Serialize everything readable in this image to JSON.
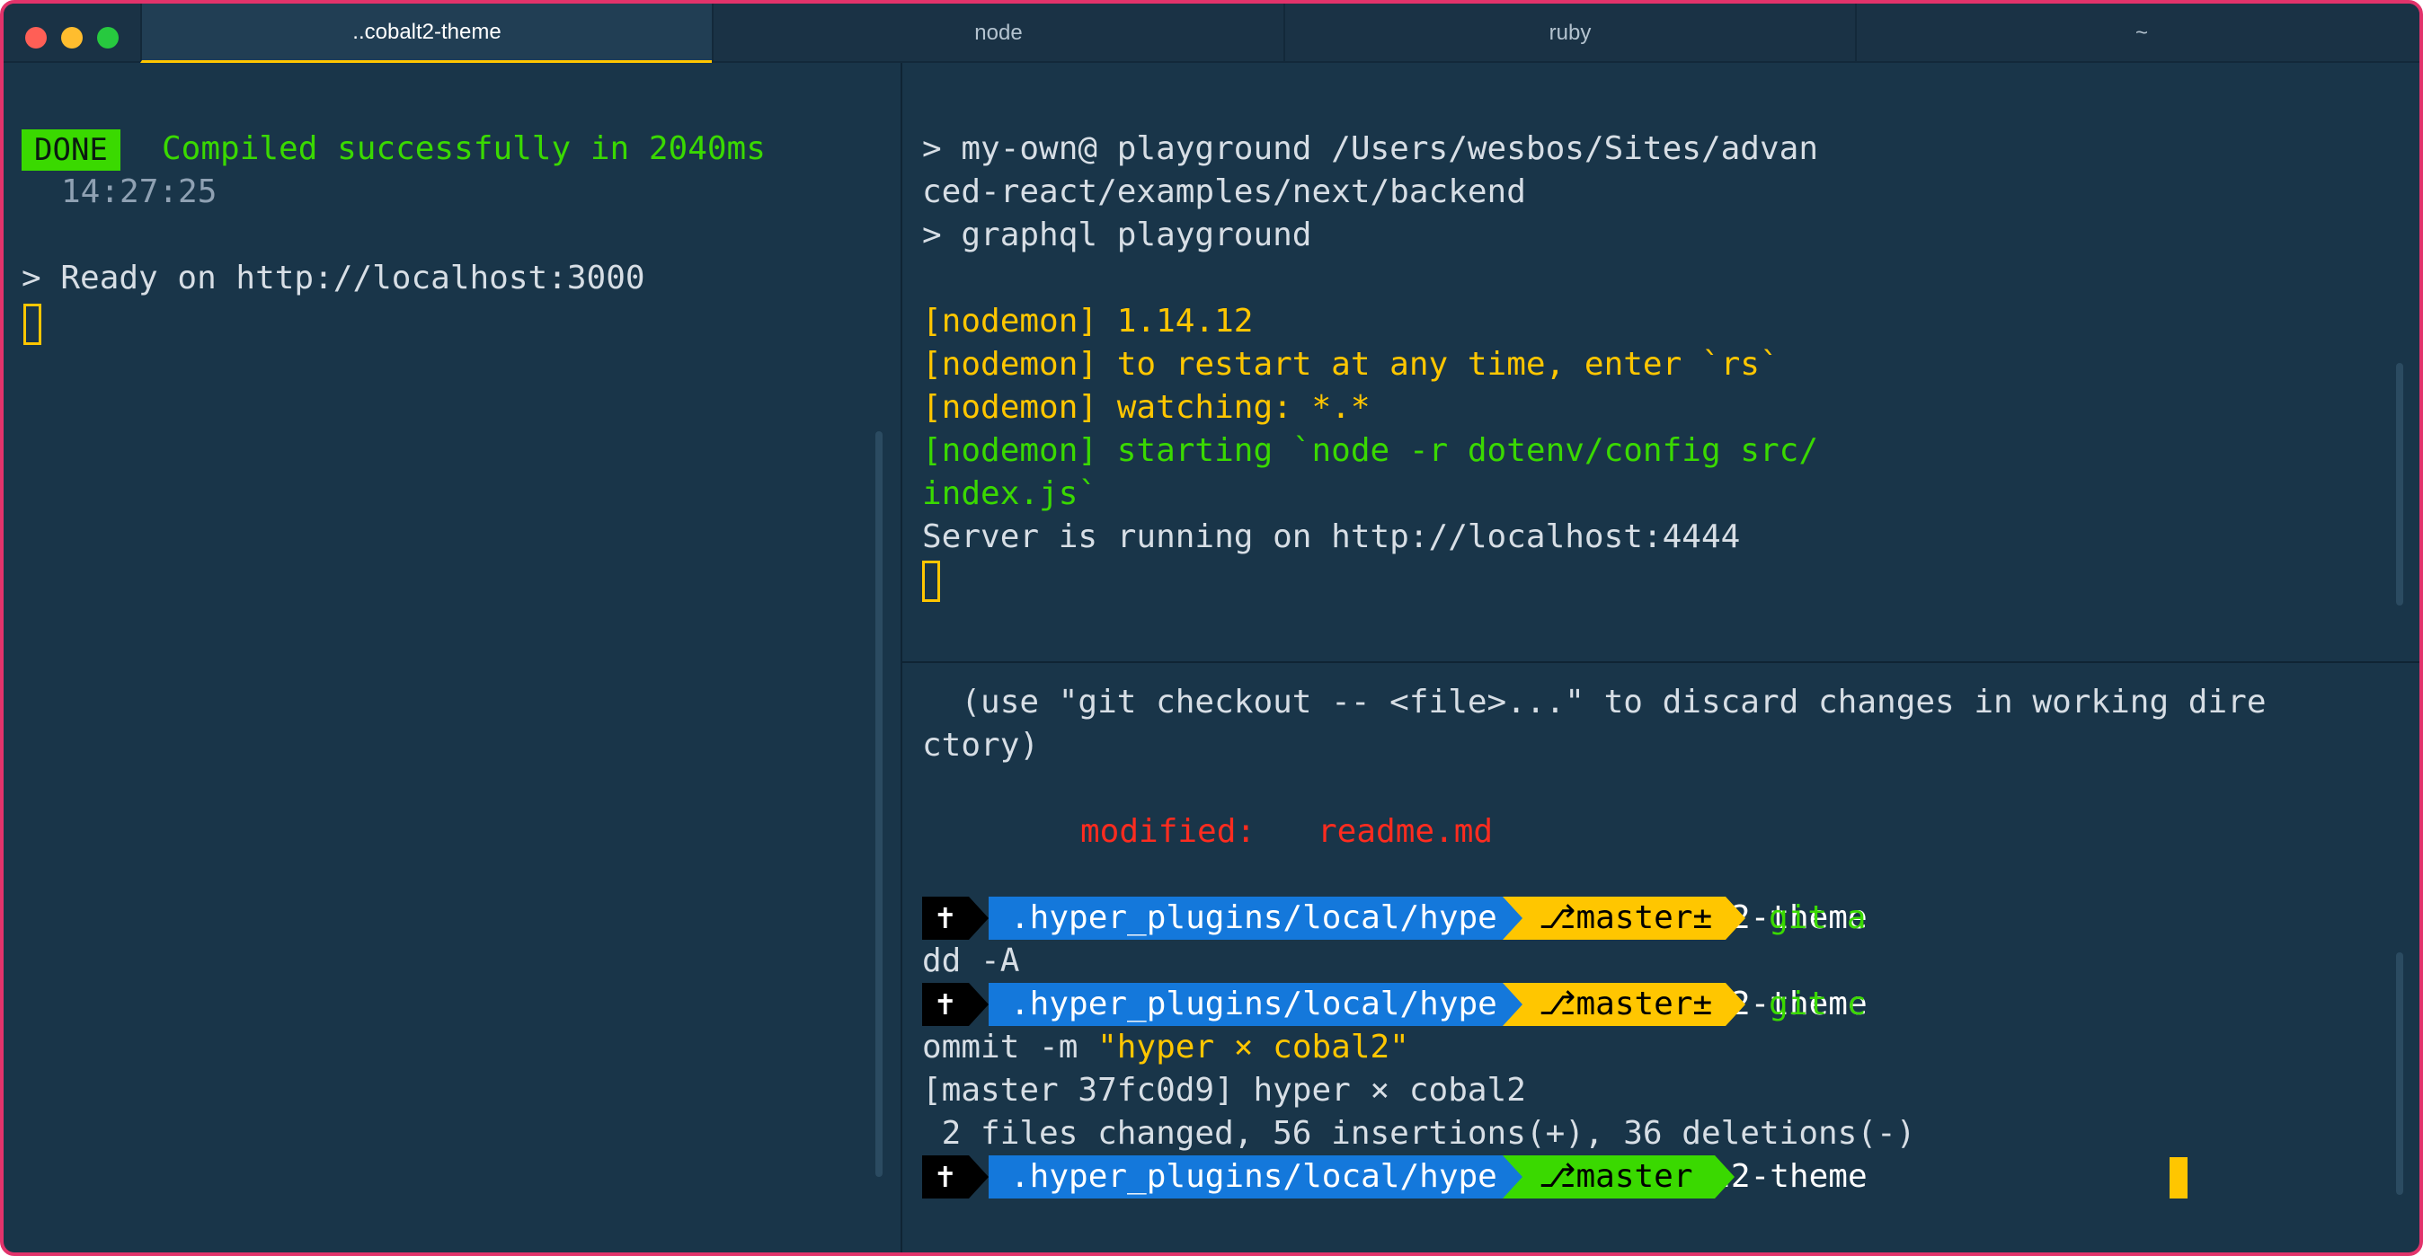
{
  "tabs": [
    {
      "label": "..cobalt2-theme",
      "active": true
    },
    {
      "label": "node",
      "active": false
    },
    {
      "label": "ruby",
      "active": false
    },
    {
      "label": "~",
      "active": false
    }
  ],
  "colors": {
    "background": "#193549",
    "accent_yellow": "#ffc600",
    "accent_green": "#3ad900",
    "error_red": "#ff2c1f",
    "path_blue": "#1478db",
    "window_border": "#e2336b"
  },
  "left_pane": {
    "done_label": "DONE",
    "compiled_msg": "Compiled successfully in 2040ms",
    "timestamp": "14:27:25",
    "ready_line": "> Ready on http://localhost:3000"
  },
  "right_top_pane": {
    "lines": [
      "> my-own@ playground /Users/wesbos/Sites/advan",
      "ced-react/examples/next/backend",
      "> graphql playground"
    ],
    "nodemon_lines": [
      "[nodemon] 1.14.12",
      "[nodemon] to restart at any time, enter `rs`",
      "[nodemon] watching: *.*"
    ],
    "nodemon_start": [
      "[nodemon] starting `node -r dotenv/config src/",
      "index.js`"
    ],
    "server_line": "Server is running on http://localhost:4444"
  },
  "right_bottom_pane": {
    "checkout_hint": [
      "  (use \"git checkout -- <file>...\" to discard changes in working dire",
      "ctory)"
    ],
    "modified_label": "modified:",
    "modified_file": "readme.md",
    "prompt_icon": "✝",
    "prompt_path": ".hyper_plugins/local/hyperterm-cobalt2-theme",
    "branch_dirty": "master±",
    "branch_clean": "master",
    "branch_icon": "⎇",
    "cmd1_start": "git a",
    "cmd1_rest": "dd -A",
    "cmd2_start": "git c",
    "cmd2_rest_plain": "ommit -m ",
    "cmd2_rest_str": "\"hyper × cobal2\"",
    "commit_line": "[master 37fc0d9] hyper × cobal2",
    "stats_line": " 2 files changed, 56 insertions(+), 36 deletions(-)"
  }
}
